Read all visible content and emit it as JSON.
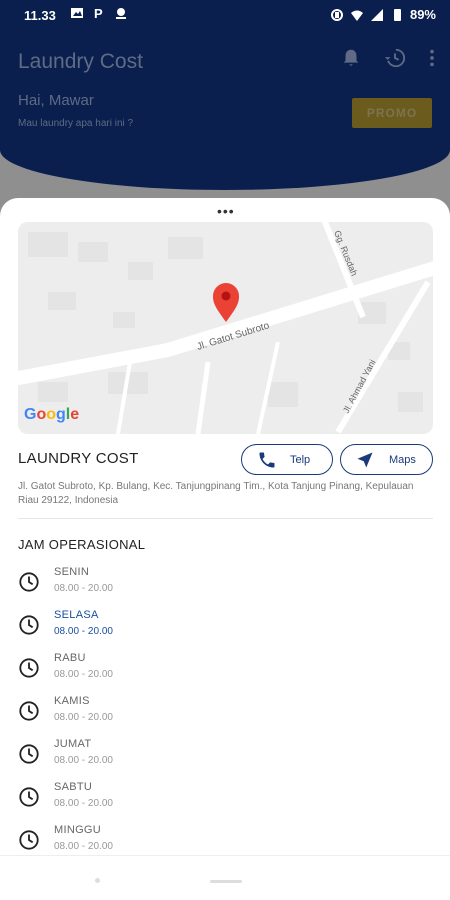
{
  "status_bar": {
    "time": "11.33",
    "battery": "89%",
    "left_icons": [
      "image-icon",
      "parking-icon",
      "data-icon"
    ],
    "right_icons": [
      "vibrate-icon",
      "wifi-icon",
      "signal-icon",
      "battery-icon"
    ]
  },
  "app": {
    "title": "Laundry Cost",
    "greeting": "Hai, Mawar",
    "subgreeting": "Mau laundry apa hari ini ?",
    "promo_label": "PROMO",
    "header_color": "#0a1f4d"
  },
  "sheet": {
    "handle": "•••",
    "map": {
      "roads": [
        "Jl. Gatot Subroto",
        "Gg. Rusdah",
        "Jl. Ahmad Yani"
      ],
      "provider": "Google"
    },
    "shop_name": "LAUNDRY COST",
    "buttons": {
      "telp": "Telp",
      "maps": "Maps"
    },
    "address": "Jl. Gatot Subroto, Kp. Bulang, Kec. Tanjungpinang Tim., Kota Tanjung Pinang, Kepulauan Riau 29122, Indonesia",
    "ops_title": "JAM OPERASIONAL",
    "days": [
      {
        "name": "SENIN",
        "hours": "08.00 - 20.00"
      },
      {
        "name": "SELASA",
        "hours": "08.00 - 20.00"
      },
      {
        "name": "RABU",
        "hours": "08.00 - 20.00"
      },
      {
        "name": "KAMIS",
        "hours": "08.00 - 20.00"
      },
      {
        "name": "JUMAT",
        "hours": "08.00 - 20.00"
      },
      {
        "name": "SABTU",
        "hours": "08.00 - 20.00"
      },
      {
        "name": "MINGGU",
        "hours": "08.00 - 20.00"
      }
    ],
    "accent_color": "#1a3a7c",
    "highlight_day_color": "#1a4ea3"
  }
}
